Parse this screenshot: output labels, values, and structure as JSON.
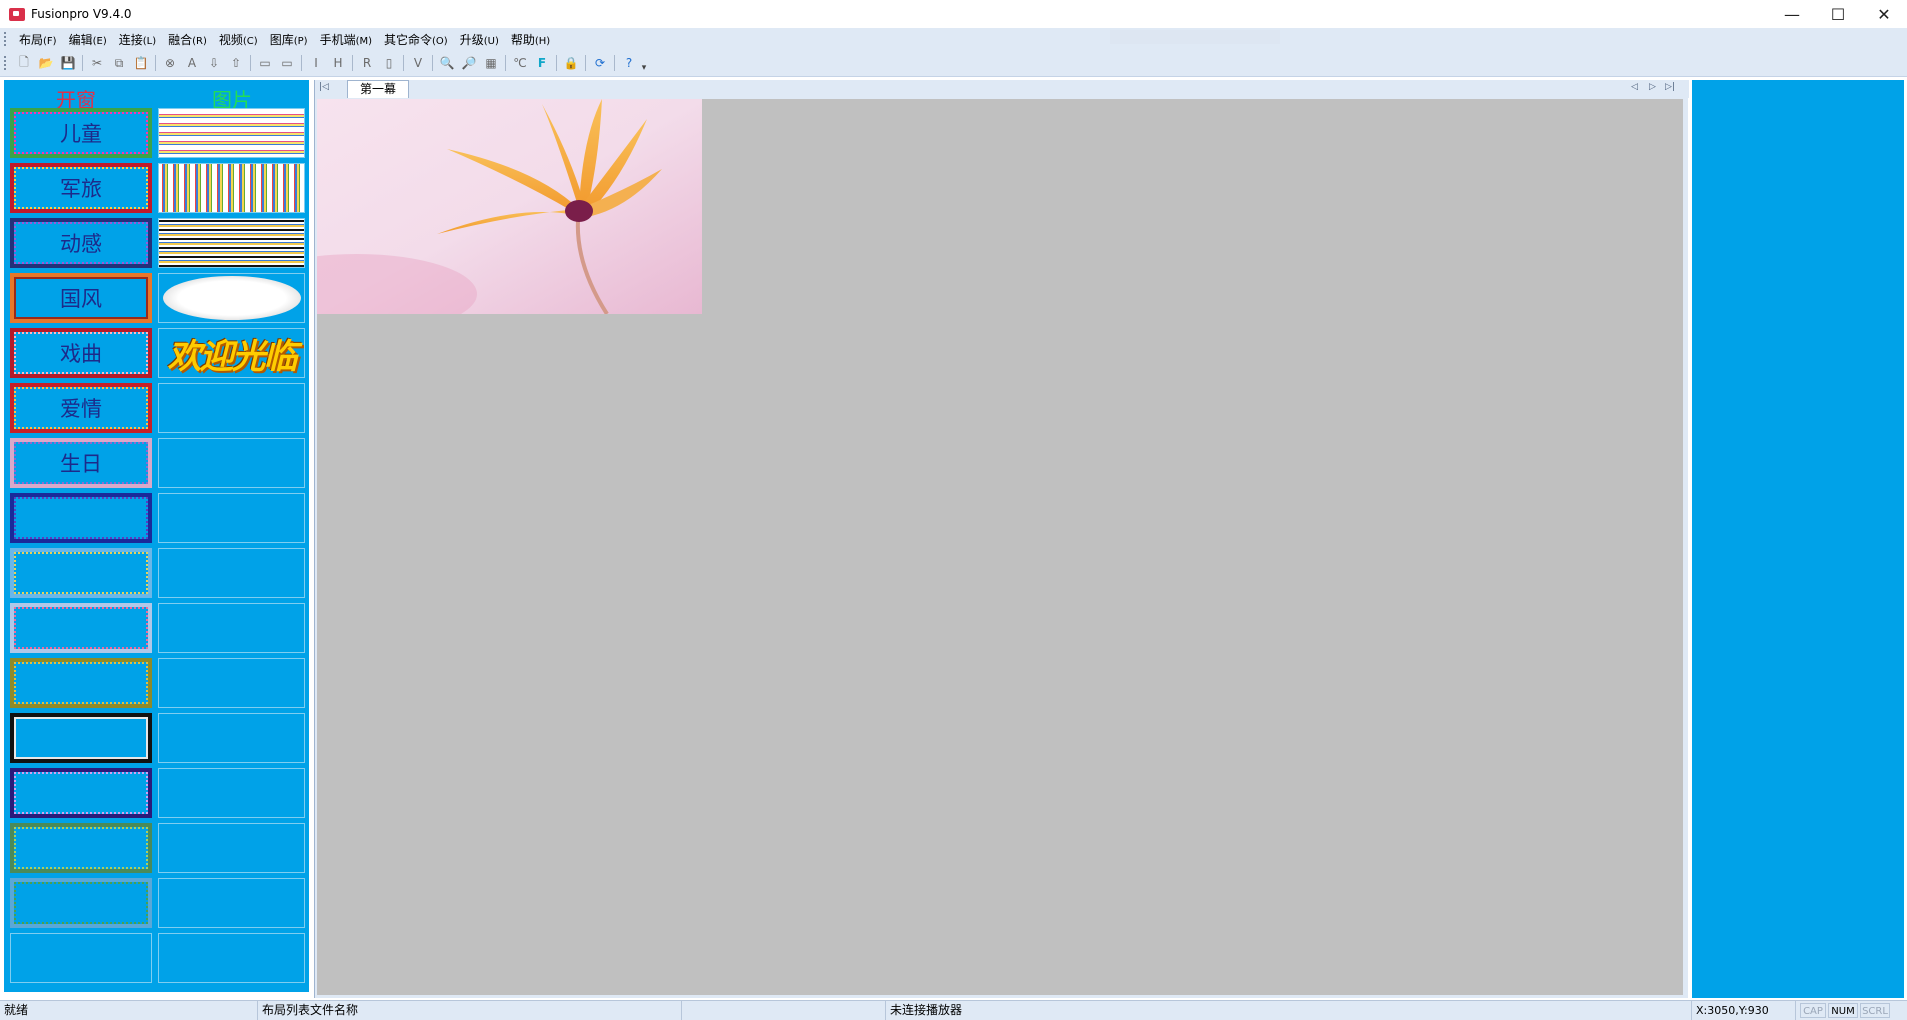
{
  "window": {
    "title": "Fusionpro V9.4.0",
    "minimize": "—",
    "maximize": "☐",
    "close": "✕"
  },
  "menu": [
    {
      "label": "布局",
      "hotkey": "(F)"
    },
    {
      "label": "编辑",
      "hotkey": "(E)"
    },
    {
      "label": "连接",
      "hotkey": "(L)"
    },
    {
      "label": "融合",
      "hotkey": "(R)"
    },
    {
      "label": "视频",
      "hotkey": "(C)"
    },
    {
      "label": "图库",
      "hotkey": "(P)"
    },
    {
      "label": "手机端",
      "hotkey": "(M)"
    },
    {
      "label": "其它命令",
      "hotkey": "(O)"
    },
    {
      "label": "升级",
      "hotkey": "(U)"
    },
    {
      "label": "帮助",
      "hotkey": "(H)"
    }
  ],
  "toolbar": {
    "glyphs": {
      "new": "🗋",
      "open": "📂",
      "save": "💾",
      "cut": "✂",
      "copy": "⧉",
      "paste": "📋",
      "delete": "⊗",
      "text": "A",
      "down": "⇩",
      "up": "⇧",
      "monitor1": "▭",
      "monitor2": "▭",
      "i": "I",
      "h": "H",
      "r": "R",
      "frame": "▯",
      "v": "V",
      "zoom_out": "🔍",
      "zoom_in": "🔎",
      "grid": "▦",
      "temp": "℃",
      "f": "F",
      "lock": "🔒",
      "refresh": "⟳",
      "help": "?"
    },
    "overflow": "▾"
  },
  "left_panel": {
    "header_open": "开窗",
    "header_picture": "图片",
    "window_templates": [
      "儿童",
      "军旅",
      "动感",
      "国风",
      "戏曲",
      "爱情",
      "生日",
      "",
      "",
      "",
      "",
      "",
      "",
      "",
      "",
      ""
    ],
    "picture_templates": [
      "欢迎光临"
    ]
  },
  "workspace": {
    "tab_first": "|◁",
    "tab_label": "第一幕",
    "nav_prev": "◁",
    "nav_next": "▷",
    "nav_last": "▷|"
  },
  "statusbar": {
    "ready": "就绪",
    "layout_file": "布局列表文件名称",
    "player": "未连接播放器",
    "coords": "X:3050,Y:930",
    "cap": "CAP",
    "num": "NUM",
    "scrl": "SCRL"
  }
}
